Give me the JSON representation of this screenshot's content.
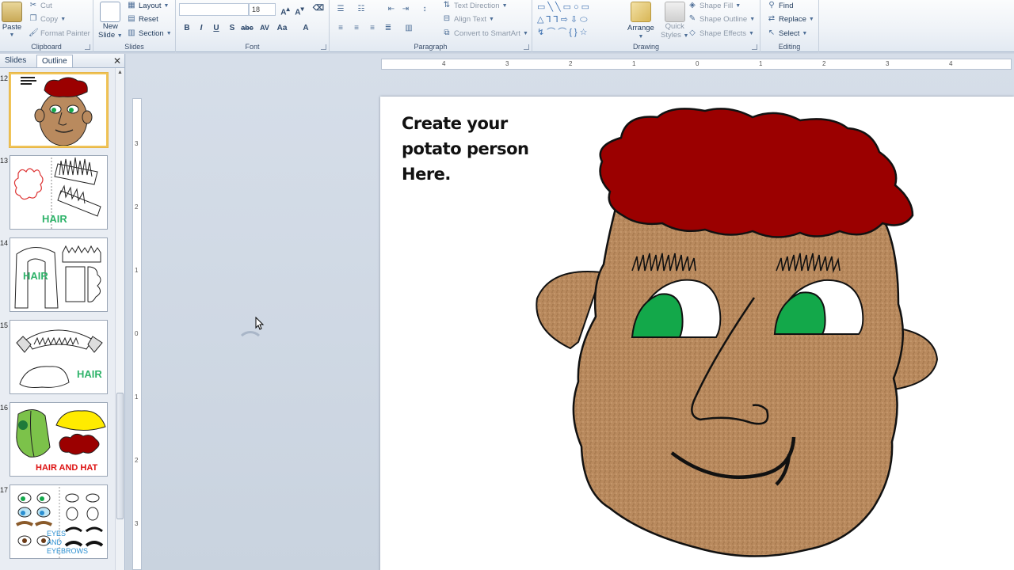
{
  "ribbon": {
    "clipboard": {
      "label": "Clipboard",
      "paste": "Paste",
      "cut": "Cut",
      "copy": "Copy",
      "format_painter": "Format Painter"
    },
    "slides": {
      "label": "Slides",
      "new_slide_line1": "New",
      "new_slide_line2": "Slide",
      "layout": "Layout",
      "reset": "Reset",
      "section": "Section"
    },
    "font": {
      "label": "Font",
      "font_name": "",
      "font_size": "18"
    },
    "paragraph": {
      "label": "Paragraph",
      "text_direction": "Text Direction",
      "align_text": "Align Text",
      "convert_smartart": "Convert to SmartArt"
    },
    "drawing": {
      "label": "Drawing",
      "arrange": "Arrange",
      "quick_styles_line1": "Quick",
      "quick_styles_line2": "Styles",
      "shape_fill": "Shape Fill",
      "shape_outline": "Shape Outline",
      "shape_effects": "Shape Effects"
    },
    "editing": {
      "label": "Editing",
      "find": "Find",
      "replace": "Replace",
      "select": "Select"
    }
  },
  "pane": {
    "tab_slides": "Slides",
    "tab_outline": "Outline",
    "thumbnails": [
      {
        "num": "12",
        "caption": ""
      },
      {
        "num": "13",
        "caption": "HAIR"
      },
      {
        "num": "14",
        "caption": "HAIR"
      },
      {
        "num": "15",
        "caption": "HAIR"
      },
      {
        "num": "16",
        "caption": "HAIR AND HAT"
      },
      {
        "num": "17",
        "caption": "EYES AND EYEBROWS"
      }
    ]
  },
  "ruler": {
    "h_ticks": [
      "4",
      "3",
      "2",
      "1",
      "0",
      "1",
      "2",
      "3",
      "4"
    ],
    "v_ticks": [
      "3",
      "2",
      "1",
      "0",
      "1",
      "2",
      "3"
    ]
  },
  "slide": {
    "text_line1": "Create your",
    "text_line2": "potato person",
    "text_line3": "Here."
  },
  "colors": {
    "hair": "#9b0000",
    "skin": "#b98a5e",
    "eye": "#13a84a",
    "accent_select": "#f0c458"
  }
}
